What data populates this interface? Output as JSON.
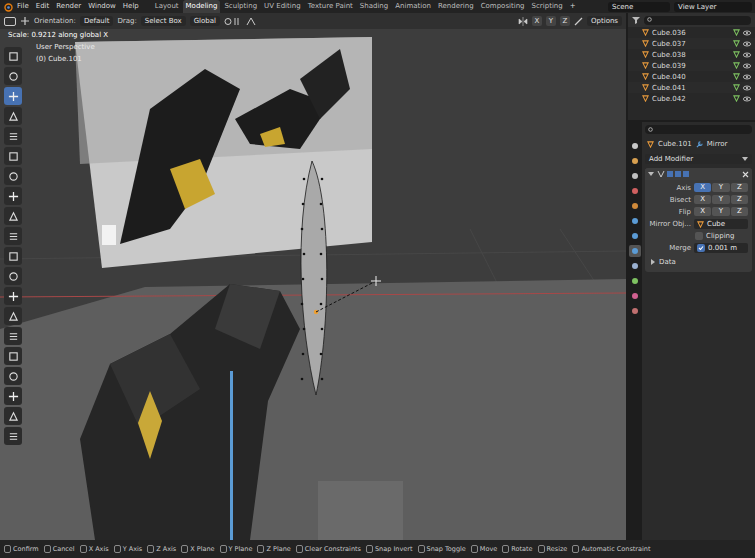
{
  "topbar": {
    "menu": [
      "File",
      "Edit",
      "Render",
      "Window",
      "Help"
    ],
    "workspaces": [
      {
        "label": "Layout",
        "selected": false
      },
      {
        "label": "Modeling",
        "selected": true
      },
      {
        "label": "Sculpting",
        "selected": false
      },
      {
        "label": "UV Editing",
        "selected": false
      },
      {
        "label": "Texture Paint",
        "selected": false
      },
      {
        "label": "Shading",
        "selected": false
      },
      {
        "label": "Animation",
        "selected": false
      },
      {
        "label": "Rendering",
        "selected": false
      },
      {
        "label": "Compositing",
        "selected": false
      },
      {
        "label": "Scripting",
        "selected": false
      }
    ],
    "add": "+",
    "scene": "Scene",
    "view_layer": "View Layer"
  },
  "header": {
    "orientation_label": "Orientation:",
    "orientation": "Default",
    "drag_label": "Drag:",
    "drag": "Select Box",
    "transform": "Global",
    "axes": [
      "X",
      "Y",
      "Z"
    ],
    "options": "Options"
  },
  "tools": [
    {
      "selected": false
    },
    {
      "selected": false
    },
    {
      "selected": true
    },
    {
      "selected": false
    },
    {
      "selected": false
    },
    {
      "selected": false
    },
    {
      "selected": false
    },
    {
      "selected": false
    },
    {
      "selected": false
    },
    {
      "selected": false
    },
    {
      "selected": false
    },
    {
      "selected": false
    },
    {
      "selected": false
    },
    {
      "selected": false
    },
    {
      "selected": false
    },
    {
      "selected": false
    },
    {
      "selected": false
    },
    {
      "selected": false
    },
    {
      "selected": false
    },
    {
      "selected": false
    }
  ],
  "viewport": {
    "operator": "Scale: 0.9212 along global X",
    "view": "User Perspective",
    "object": "(0) Cube.101"
  },
  "outliner": {
    "items": [
      {
        "name": "Cube.036"
      },
      {
        "name": "Cube.037"
      },
      {
        "name": "Cube.038"
      },
      {
        "name": "Cube.039"
      },
      {
        "name": "Cube.040"
      },
      {
        "name": "Cube.041"
      },
      {
        "name": "Cube.042"
      }
    ]
  },
  "property_tabs": [
    {
      "selected": false
    },
    {
      "selected": false
    },
    {
      "selected": false
    },
    {
      "selected": false
    },
    {
      "selected": false
    },
    {
      "selected": false
    },
    {
      "selected": false
    },
    {
      "selected": true
    },
    {
      "selected": false
    },
    {
      "selected": false
    },
    {
      "selected": false
    },
    {
      "selected": false
    }
  ],
  "properties": {
    "object": "Cube.101",
    "modifier": "Mirror",
    "add_modifier": "Add Modifier",
    "axis_rows": [
      {
        "label": "Axis",
        "options": [
          {
            "label": "X",
            "selected": true
          },
          {
            "label": "Y",
            "selected": false
          },
          {
            "label": "Z",
            "selected": false
          }
        ]
      },
      {
        "label": "Bisect",
        "options": [
          {
            "label": "X",
            "selected": false
          },
          {
            "label": "Y",
            "selected": false
          },
          {
            "label": "Z",
            "selected": false
          }
        ]
      },
      {
        "label": "Flip",
        "options": [
          {
            "label": "X",
            "selected": false
          },
          {
            "label": "Y",
            "selected": false
          },
          {
            "label": "Z",
            "selected": false
          }
        ]
      }
    ],
    "mirror_object": {
      "label": "Mirror Obj...",
      "value": "Cube"
    },
    "clipping": {
      "label": "Clipping",
      "checked": false
    },
    "merge": {
      "label": "Merge",
      "checked": true,
      "value": "0.001 m"
    },
    "data": {
      "label": "Data",
      "expanded": false
    }
  },
  "status_bar": [
    "Confirm",
    "Cancel",
    "X Axis",
    "Y Axis",
    "Z Axis",
    "X Plane",
    "Y Plane",
    "Z Plane",
    "Clear Constraints",
    "Snap Invert",
    "Snap Toggle",
    "Move",
    "Rotate",
    "Resize",
    "Automatic Constraint"
  ]
}
